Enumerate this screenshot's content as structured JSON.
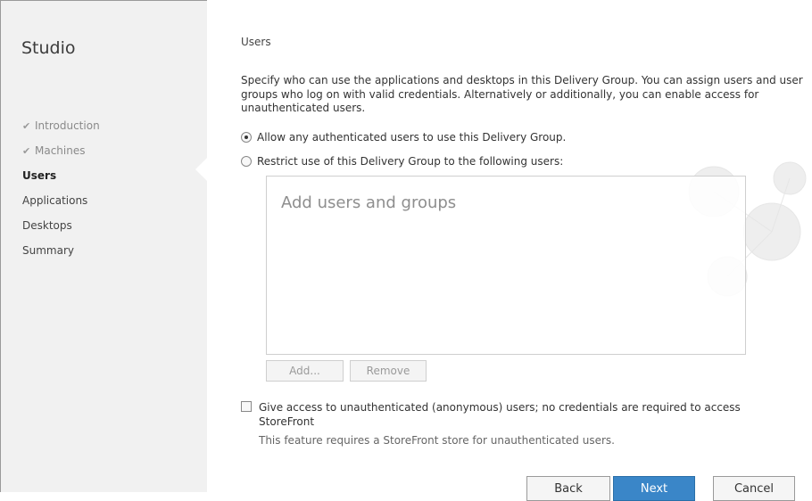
{
  "sidebar": {
    "title": "Studio",
    "steps": [
      {
        "label": "Introduction",
        "state": "done"
      },
      {
        "label": "Machines",
        "state": "done"
      },
      {
        "label": "Users",
        "state": "current"
      },
      {
        "label": "Applications",
        "state": "pending"
      },
      {
        "label": "Desktops",
        "state": "pending"
      },
      {
        "label": "Summary",
        "state": "pending"
      }
    ]
  },
  "main": {
    "title": "Users",
    "description": "Specify who can use the applications and desktops in this Delivery Group. You can assign users and user groups who log on with valid credentials. Alternatively or additionally, you can enable access for unauthenticated users.",
    "radio_allow": {
      "label": "Allow any authenticated users to use this Delivery Group.",
      "selected": true
    },
    "radio_restrict": {
      "label": "Restrict use of this Delivery Group to the following users:",
      "selected": false
    },
    "users_box": {
      "placeholder": "Add users and groups"
    },
    "add_button": "Add...",
    "remove_button": "Remove",
    "anonymous_checkbox": {
      "label": "Give access to unauthenticated (anonymous) users; no credentials are required to access StoreFront",
      "checked": false
    },
    "anonymous_note": "This feature requires a StoreFront store for unauthenticated users."
  },
  "footer": {
    "back": "Back",
    "next": "Next",
    "cancel": "Cancel"
  },
  "colors": {
    "sidebar_bg": "#f1f1f1",
    "primary_button": "#3a86c8",
    "watermark": "#ececec"
  }
}
